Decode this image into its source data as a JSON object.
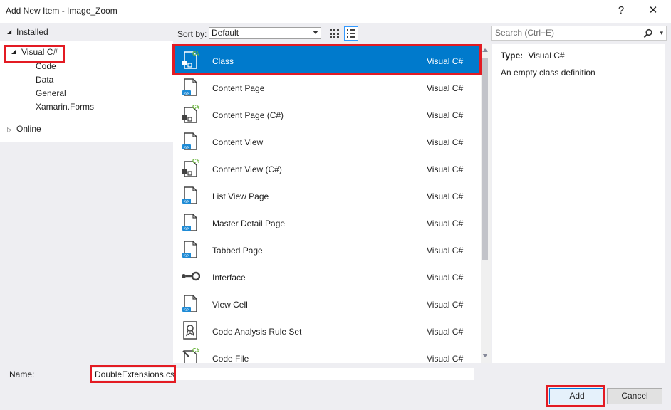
{
  "window": {
    "title": "Add New Item - Image_Zoom",
    "help_label": "?",
    "close_label": "✕"
  },
  "tree": {
    "installed_label": "Installed",
    "visual_csharp_label": "Visual C#",
    "children": [
      "Code",
      "Data",
      "General",
      "Xamarin.Forms"
    ],
    "online_label": "Online"
  },
  "toolbar": {
    "sort_label": "Sort by:",
    "sort_value": "Default"
  },
  "search": {
    "placeholder": "Search (Ctrl+E)"
  },
  "items": [
    {
      "name": "Class",
      "lang": "Visual C#",
      "icon": "class-icon",
      "selected": true
    },
    {
      "name": "Content Page",
      "lang": "Visual C#",
      "icon": "xaml-page-icon"
    },
    {
      "name": "Content Page (C#)",
      "lang": "Visual C#",
      "icon": "csharp-page-icon"
    },
    {
      "name": "Content View",
      "lang": "Visual C#",
      "icon": "xaml-page-icon"
    },
    {
      "name": "Content View (C#)",
      "lang": "Visual C#",
      "icon": "csharp-page-icon"
    },
    {
      "name": "List View Page",
      "lang": "Visual C#",
      "icon": "xaml-page-icon"
    },
    {
      "name": "Master Detail Page",
      "lang": "Visual C#",
      "icon": "xaml-page-icon"
    },
    {
      "name": "Tabbed Page",
      "lang": "Visual C#",
      "icon": "xaml-page-icon"
    },
    {
      "name": "Interface",
      "lang": "Visual C#",
      "icon": "interface-icon"
    },
    {
      "name": "View Cell",
      "lang": "Visual C#",
      "icon": "xaml-page-icon"
    },
    {
      "name": "Code Analysis Rule Set",
      "lang": "Visual C#",
      "icon": "ruleset-icon"
    },
    {
      "name": "Code File",
      "lang": "Visual C#",
      "icon": "code-file-icon"
    }
  ],
  "details": {
    "type_label": "Type:",
    "type_value": "Visual C#",
    "description": "An empty class definition"
  },
  "footer": {
    "name_label": "Name:",
    "name_value": "DoubleExtensions.cs",
    "add_label": "Add",
    "cancel_label": "Cancel"
  },
  "colors": {
    "selection": "#007acc",
    "highlight": "#e31b23",
    "panel": "#eeeef2"
  }
}
